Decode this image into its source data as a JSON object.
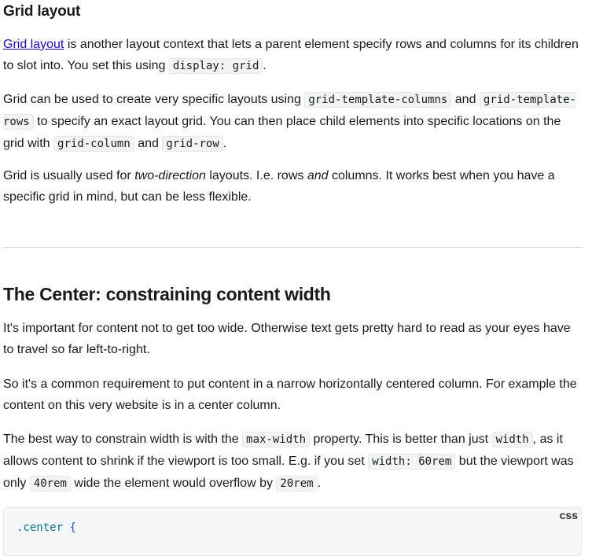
{
  "section1": {
    "heading": "Grid layout",
    "p1": {
      "link": "Grid layout",
      "t1": " is another layout context that lets a parent element specify rows and columns for its children to slot into. You set this using ",
      "code1": "display: grid",
      "t2": "."
    },
    "p2": {
      "t1": "Grid can be used to create very specific layouts using ",
      "code1": "grid-template-columns",
      "t2": " and ",
      "code2": "grid-template-rows",
      "t3": " to specify an exact layout grid. You can then place child elements into specific locations on the grid with ",
      "code3": "grid-column",
      "t4": " and ",
      "code4": "grid-row",
      "t5": "."
    },
    "p3": {
      "t1": "Grid is usually used for ",
      "em1": "two-direction",
      "t2": " layouts. I.e. rows ",
      "em2": "and",
      "t3": " columns. It works best when you have a specific grid in mind, but can be less flexible."
    }
  },
  "section2": {
    "heading": "The Center: constraining content width",
    "p1": "It's important for content not to get too wide. Otherwise text gets pretty hard to read as your eyes have to travel so far left-to-right.",
    "p2": "So it's a common requirement to put content in a narrow horizontally centered column. For example the content on this very website is in a center column.",
    "p3": {
      "t1": "The best way to constrain width is with the ",
      "code1": "max-width",
      "t2": " property. This is better than just ",
      "code2": "width",
      "t3": ", as it allows content to shrink if the viewport is too small. E.g. if you set ",
      "code3": "width: 60rem",
      "t4": " but the viewport was only ",
      "code4": "40rem",
      "t5": " wide the element would overflow by ",
      "code5": "20rem",
      "t6": "."
    },
    "codeblock": {
      "language": "css",
      "selector": ".center",
      "brace": "{"
    }
  }
}
